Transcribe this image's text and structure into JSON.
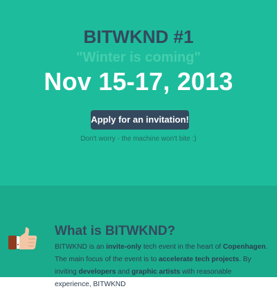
{
  "hero": {
    "title": "BITWKND #1",
    "tagline": "\"Winter is coming\"",
    "dates": "Nov 15-17, 2013",
    "apply_label": "Apply for an invitation!",
    "reassurance": "Don't worry - the machine won't bite :)"
  },
  "about": {
    "icon": "thumbs-up-icon",
    "heading": "What is BITWKND?",
    "p1": "BITWKND is an ",
    "p1_bold": "invite-only",
    "p2": " tech event in the heart of ",
    "p2_bold": "Copenhagen",
    "p3": ". The main focus of the event is to ",
    "p3_bold": "accelerate tech projects",
    "p4": ". By inviting ",
    "p4_bold": "developers",
    "p5": " and ",
    "p5_bold": "graphic artists",
    "p6": " with reasonable experience, BITWKND"
  },
  "colors": {
    "hero_bg": "#1dbc9c",
    "info_bg": "#1aab8c",
    "dark": "#34495e",
    "tagline": "#45cfae"
  }
}
